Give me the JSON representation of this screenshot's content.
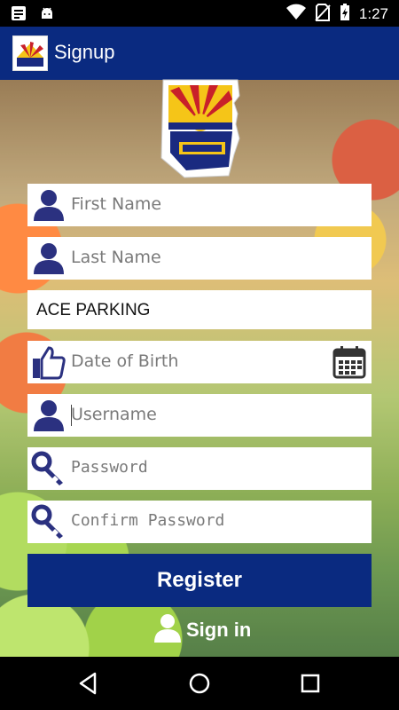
{
  "status_bar": {
    "time": "1:27",
    "icons": [
      "notes-icon",
      "android-icon",
      "wifi-icon",
      "no-sim-icon",
      "battery-charging-icon"
    ]
  },
  "app_bar": {
    "title": "Signup",
    "logo": "ufcw-logo"
  },
  "form": {
    "first_name": {
      "placeholder": "First Name",
      "icon": "person-icon"
    },
    "last_name": {
      "placeholder": "Last Name",
      "icon": "person-icon"
    },
    "employer": {
      "value": "ACE PARKING"
    },
    "date_of_birth": {
      "placeholder": "Date of Birth",
      "icon": "thumbs-up-icon",
      "picker_icon": "calendar-icon"
    },
    "username": {
      "placeholder": "Username",
      "icon": "person-icon"
    },
    "password": {
      "placeholder": "Password",
      "icon": "key-icon"
    },
    "confirm_password": {
      "placeholder": "Confirm Password",
      "icon": "key-icon"
    }
  },
  "buttons": {
    "register": "Register",
    "sign_in": "Sign in"
  },
  "nav_bar": {
    "icons": [
      "back-icon",
      "home-icon",
      "recents-icon"
    ]
  },
  "colors": {
    "primary": "#0a2a80",
    "icon": "#2b3180",
    "field_bg": "#ffffff",
    "placeholder": "#7a7a7a"
  }
}
